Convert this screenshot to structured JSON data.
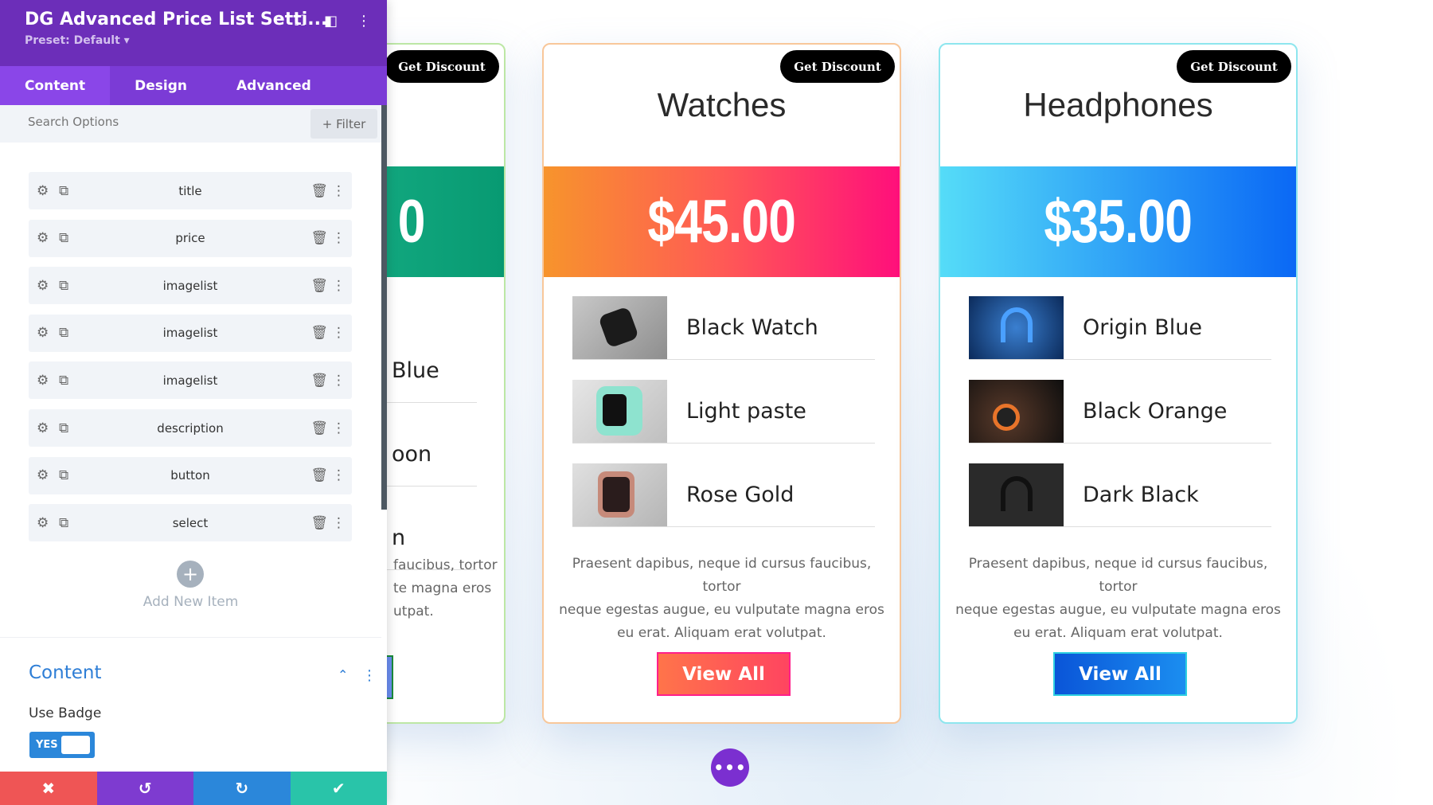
{
  "panel": {
    "title": "DG Advanced Price List Setti...",
    "preset": "Preset: Default ▾",
    "tabs": [
      "Content",
      "Design",
      "Advanced"
    ],
    "search_placeholder": "Search Options",
    "filter_label": "+ Filter",
    "items": [
      "title",
      "price",
      "imagelist",
      "imagelist",
      "imagelist",
      "description",
      "button",
      "select"
    ],
    "add_new_item": "Add New Item",
    "section_title": "Content",
    "use_badge_label": "Use Badge",
    "toggle_value": "YES"
  },
  "cards": [
    {
      "badge": "Get Discount",
      "price_partial": "0",
      "items_partial": [
        "Blue",
        "oon",
        "n"
      ],
      "desc_partial": [
        "faucibus, tortor",
        "te magna eros",
        "utpat."
      ],
      "border": "#bde7a5"
    },
    {
      "badge": "Get Discount",
      "title": "Watches",
      "price": "$45.00",
      "items": [
        "Black Watch",
        "Light paste",
        "Rose Gold"
      ],
      "desc": [
        "Praesent dapibus, neque id cursus faucibus, tortor",
        "neque egestas augue, eu vulputate magna eros",
        "eu erat. Aliquam erat volutpat."
      ],
      "button": "View All",
      "border": "#f8c79a"
    },
    {
      "badge": "Get Discount",
      "title": "Headphones",
      "price": "$35.00",
      "items": [
        "Origin Blue",
        "Black Orange",
        "Dark Black"
      ],
      "desc": [
        "Praesent dapibus, neque id cursus faucibus, tortor",
        "neque egestas augue, eu vulputate magna eros",
        "eu erat. Aliquam erat volutpat."
      ],
      "button": "View All",
      "border": "#8ee6ee"
    }
  ],
  "colors": {
    "panel_header": "#6c2eb9",
    "tabs": "#7b3bd6",
    "cancel": "#ef5555",
    "undo": "#7e3bd0",
    "redo": "#2b87da",
    "save": "#29c4a9"
  }
}
